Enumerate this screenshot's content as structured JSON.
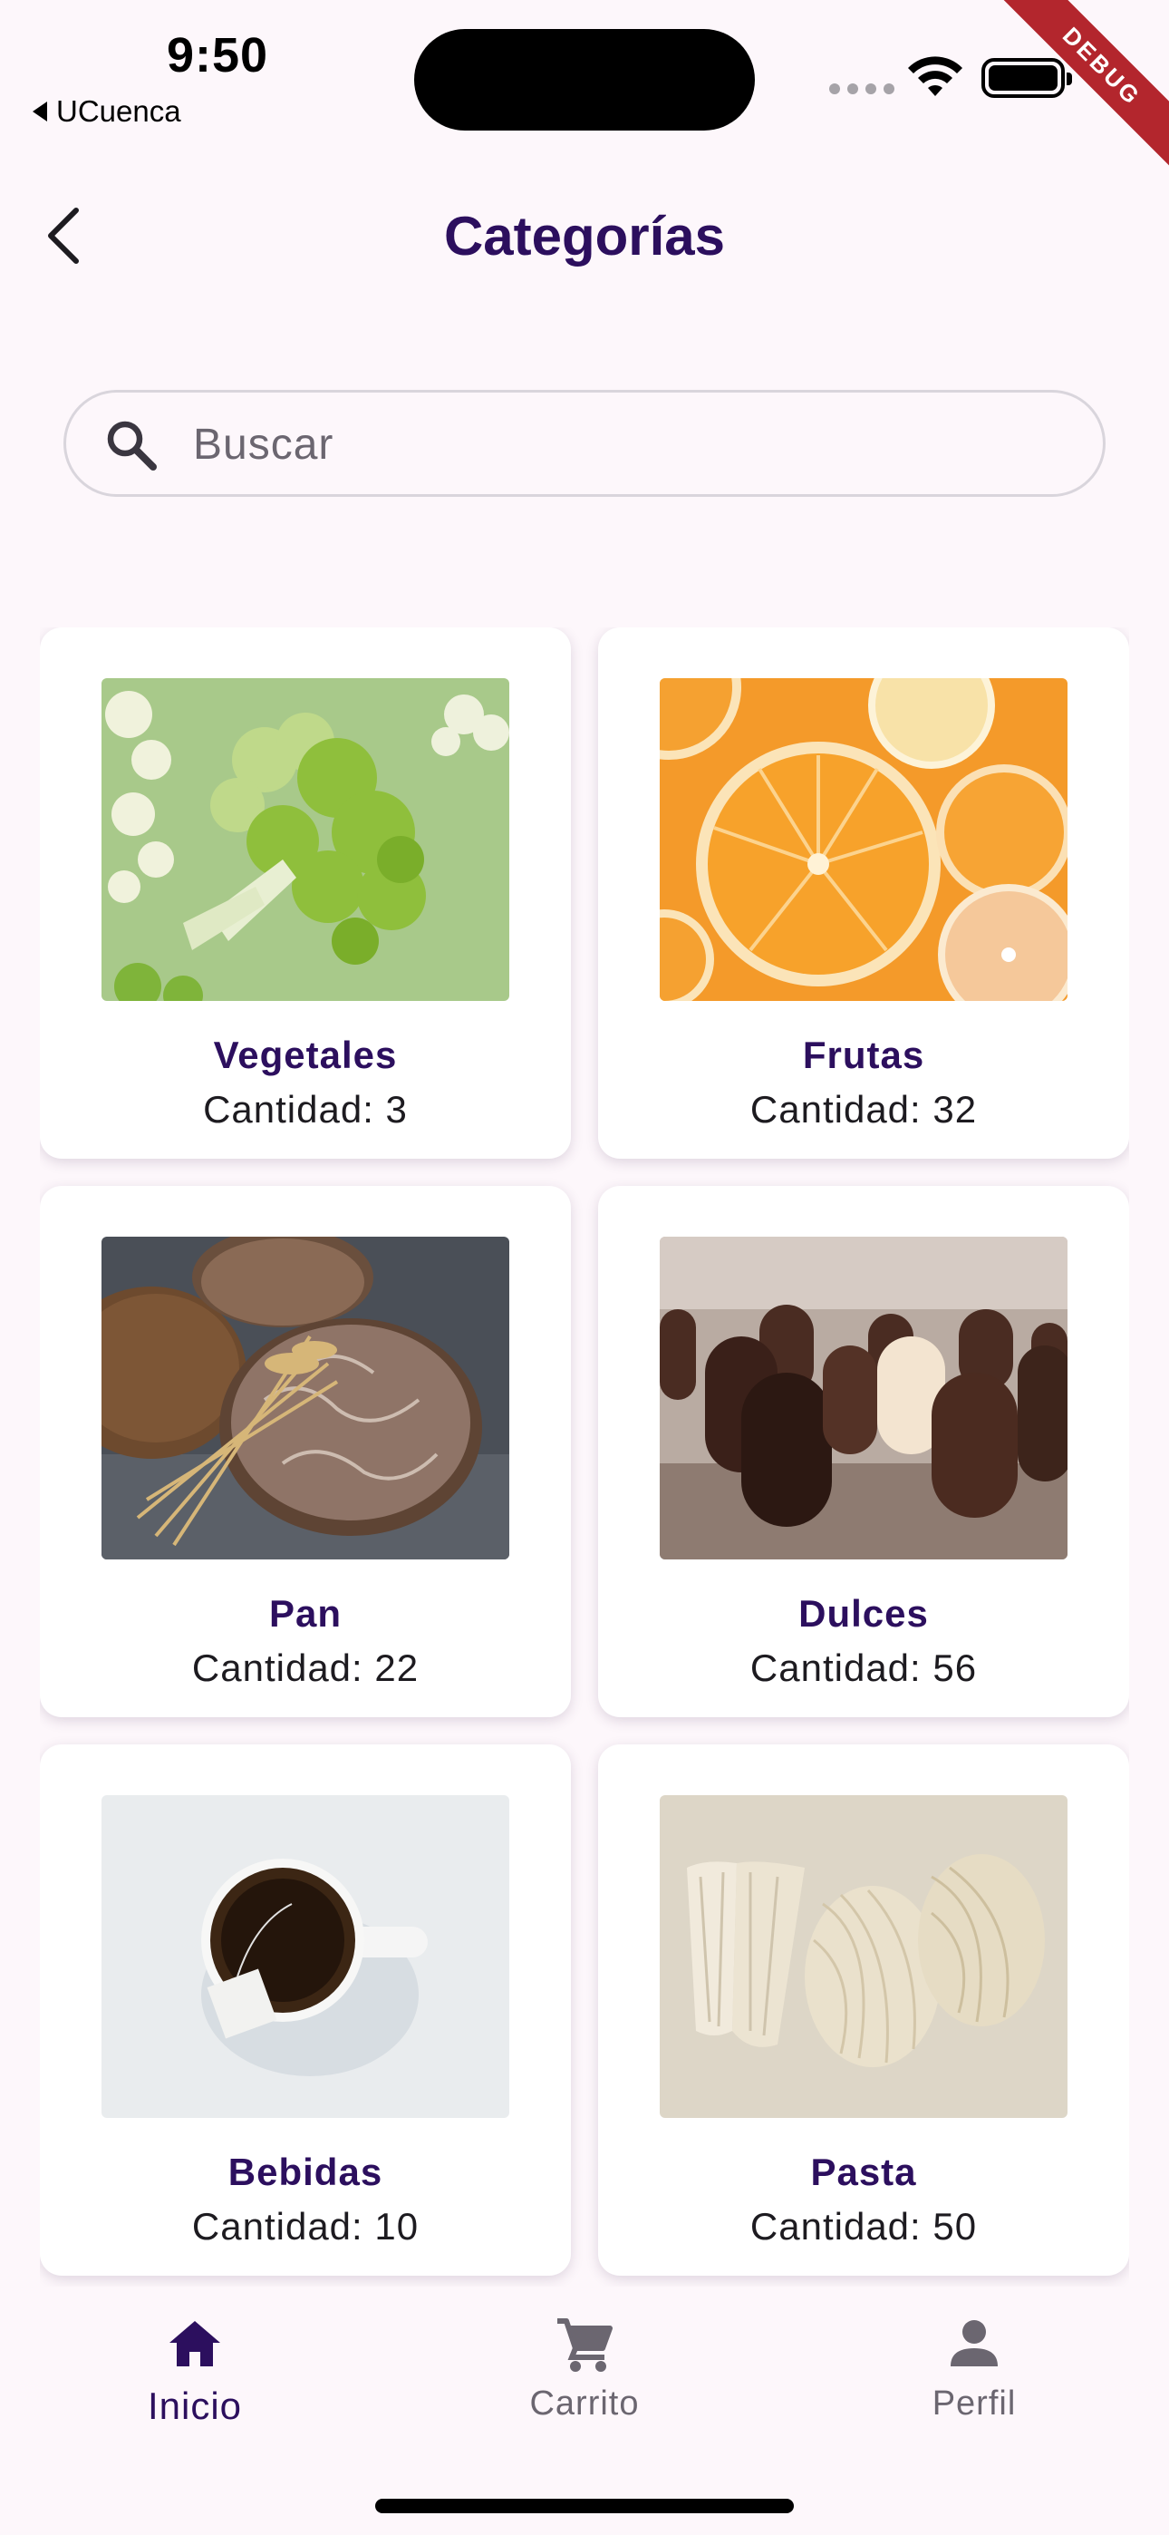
{
  "status_bar": {
    "time": "9:50",
    "back_app": "UCuenca",
    "debug_banner": "DEBUG"
  },
  "header": {
    "title": "Categorías"
  },
  "search": {
    "placeholder": "Buscar",
    "value": ""
  },
  "categories": [
    {
      "name": "Vegetales",
      "count": "Cantidad: 3",
      "image": "broccoli"
    },
    {
      "name": "Frutas",
      "count": "Cantidad: 32",
      "image": "orange-slices"
    },
    {
      "name": "Pan",
      "count": "Cantidad: 22",
      "image": "bread-loaves"
    },
    {
      "name": "Dulces",
      "count": "Cantidad: 56",
      "image": "chocolate-marshmallows"
    },
    {
      "name": "Bebidas",
      "count": "Cantidad: 10",
      "image": "tea-cup"
    },
    {
      "name": "Pasta",
      "count": "Cantidad: 50",
      "image": "pasta-bundles"
    }
  ],
  "bottom_nav": {
    "items": [
      {
        "label": "Inicio",
        "icon": "home-icon",
        "active": true
      },
      {
        "label": "Carrito",
        "icon": "cart-icon",
        "active": false
      },
      {
        "label": "Perfil",
        "icon": "person-icon",
        "active": false
      }
    ]
  },
  "colors": {
    "accent": "#2c0f5e",
    "background": "#fdf7fb",
    "debug": "#b3262d"
  }
}
